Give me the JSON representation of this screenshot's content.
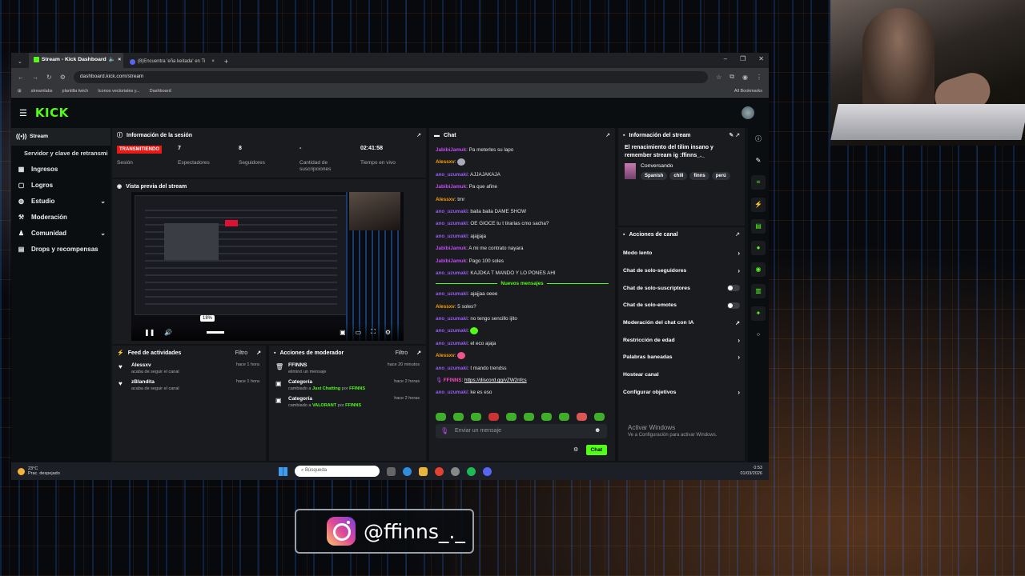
{
  "browser": {
    "tabs": [
      {
        "label": "Stream - Kick Dashboard"
      },
      {
        "label": "(8)Encuentra 'eña keitada' en Ti"
      }
    ],
    "url": "dashboard.kick.com/stream",
    "bookmarks": [
      {
        "label": "streamlabs"
      },
      {
        "label": "plantilla twich"
      },
      {
        "label": "Iconos vectoriales y..."
      },
      {
        "label": "Dashboard"
      }
    ],
    "all_bookmarks": "All Bookmarks"
  },
  "kick": {
    "logo": "KICK"
  },
  "sidebar": {
    "items": [
      {
        "label": "Stream"
      },
      {
        "label": "Servidor y clave de retransmi"
      },
      {
        "label": "Ingresos"
      },
      {
        "label": "Logros"
      },
      {
        "label": "Estudio"
      },
      {
        "label": "Moderación"
      },
      {
        "label": "Comunidad"
      },
      {
        "label": "Drops y recompensas"
      }
    ]
  },
  "session": {
    "title": "Información de la sesión",
    "status": "TRANSMITIENDO",
    "status_label": "Sesión",
    "stats": [
      {
        "value": "7",
        "label": "Espectadores"
      },
      {
        "value": "8",
        "label": "Seguidores"
      },
      {
        "value": "-",
        "label": "Cantidad de suscripciones"
      },
      {
        "value": "02:41:58",
        "label": "Tiempo en vivo"
      }
    ]
  },
  "preview": {
    "title": "Vista previa del stream",
    "volume": "18%"
  },
  "feed": {
    "title": "Feed de actividades",
    "filter": "Filtro",
    "items": [
      {
        "name": "Alessxv",
        "sub": "acaba de seguir el canal",
        "time": "hace 1 hora"
      },
      {
        "name": "zBlandita",
        "sub": "acaba de seguir el canal",
        "time": "hace 1 hora"
      }
    ]
  },
  "modactions": {
    "title": "Acciones de moderador",
    "filter": "Filtro",
    "items": [
      {
        "name": "FFINNS",
        "sub": "eliminó un mensaje",
        "time": "hace 20 minutos"
      },
      {
        "name": "Categoría",
        "sub_pre": "cambiado a ",
        "sub_hl": "Just Chatting",
        "sub_mid": " por ",
        "sub_user": "FFINNS",
        "time": "hace 2 horas"
      },
      {
        "name": "Categoría",
        "sub_pre": "cambiado a ",
        "sub_hl": "VALORANT",
        "sub_mid": " por ",
        "sub_user": "FFINNS",
        "time": "hace 2 horas"
      }
    ]
  },
  "chat": {
    "title": "Chat",
    "messages_before": [
      {
        "user": "JabibiJamuk",
        "text": ": Pa meterles su lapo"
      },
      {
        "user": "Alessxv",
        "text": ": "
      },
      {
        "user": "ano_uzumaki",
        "text": ": AJJAJAKAJA"
      },
      {
        "user": "JabibiJamuk",
        "text": ": Pa que afine"
      },
      {
        "user": "Alessxv",
        "text": ": tmr"
      },
      {
        "user": "ano_uzumaki",
        "text": ": baila baila DAME SHOW"
      },
      {
        "user": "ano_uzumaki",
        "text": ": OE GIOCE tu t tirarias cmo sacha?"
      },
      {
        "user": "ano_uzumaki",
        "text": ": ajajjaja"
      },
      {
        "user": "JabibiJamuk",
        "text": ": A mi me contrato nayara"
      },
      {
        "user": "JabibiJamuk",
        "text": ": Pago 100 soles"
      },
      {
        "user": "ano_uzumaki",
        "text": ": KAJDKA T MANDO Y LO PONES AHI"
      }
    ],
    "new_messages": "Nuevos mensajes",
    "messages_after": [
      {
        "user": "ano_uzumaki",
        "text": ": ajajjaa oeee"
      },
      {
        "user": "Alessxv",
        "text": ": 5 soles?"
      },
      {
        "user": "ano_uzumaki",
        "text": ": no tengo sencillo ijito"
      },
      {
        "user": "ano_uzumaki",
        "text": ": "
      },
      {
        "user": "ano_uzumaki",
        "text": ": el eco ajaja"
      },
      {
        "user": "Alessxv",
        "text": ": "
      },
      {
        "user": "ano_uzumaki",
        "text": ": t mando trendss"
      },
      {
        "user": "FFINNS",
        "text": ": ",
        "link": "https://discord.gg/vZW2nfcs"
      },
      {
        "user": "ano_uzumaki",
        "text": ": ke es eso"
      }
    ],
    "placeholder": "Enviar un mensaje",
    "send": "Chat"
  },
  "streaminfo": {
    "title": "Información del stream",
    "stream_title": "El renacimiento del tilim insano y remember stream ig :ffinns_._",
    "category": "Conversando",
    "tags": [
      "Spanish",
      "chill",
      "finns",
      "perú"
    ]
  },
  "channel": {
    "title": "Acciones de canal",
    "actions": [
      {
        "label": "Modo lento",
        "kind": "chevron"
      },
      {
        "label": "Chat de solo-seguidores",
        "kind": "chevron"
      },
      {
        "label": "Chat de solo-suscriptores",
        "kind": "toggle"
      },
      {
        "label": "Chat de solo-emotes",
        "kind": "toggle"
      },
      {
        "label": "Moderación del chat con IA",
        "kind": "external"
      },
      {
        "label": "Restricción de edad",
        "kind": "chevron"
      },
      {
        "label": "Palabras baneadas",
        "kind": "chevron"
      },
      {
        "label": "Hostear canal",
        "kind": "none"
      },
      {
        "label": "Configurar objetivos",
        "kind": "chevron"
      }
    ]
  },
  "windows": {
    "activate_title": "Activar Windows",
    "activate_sub": "Ve a Configuración para activar Windows."
  },
  "taskbar": {
    "temp": "23°C",
    "weather": "Prac. despejado",
    "search": "Búsqueda",
    "time": "0:53",
    "date": "01/03/2026"
  },
  "overlay": {
    "handle": "@ffinns_._"
  },
  "colors": {
    "kick_green": "#53fc18",
    "live_red": "#e91916",
    "panel": "#191b1f"
  }
}
